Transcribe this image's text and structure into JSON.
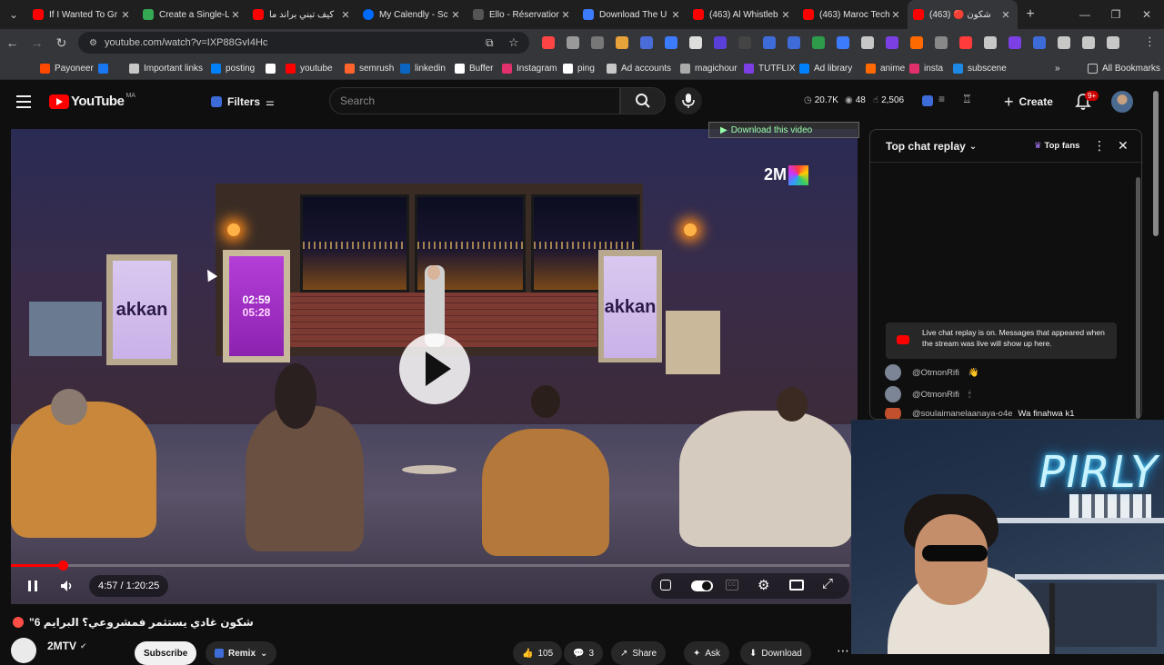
{
  "browser": {
    "tabs": [
      {
        "title": "If I Wanted To Gr",
        "icon": "youtube-icon",
        "color": "#ff0000"
      },
      {
        "title": "Create a Single-L",
        "icon": "sheets-icon",
        "color": "#34a853"
      },
      {
        "title": "كيف تبني براند ما",
        "icon": "youtube-icon",
        "color": "#ff0000"
      },
      {
        "title": "My Calendly - Sc",
        "icon": "calendly-icon",
        "color": "#006bff"
      },
      {
        "title": "Ello - Réservation",
        "icon": "ello-icon",
        "color": "#555555"
      },
      {
        "title": "Download The U",
        "icon": "download-icon",
        "color": "#3d7bfd"
      },
      {
        "title": "(463) Al Whistleb",
        "icon": "youtube-icon",
        "color": "#ff0000"
      },
      {
        "title": "(463) Maroc Tech",
        "icon": "youtube-icon",
        "color": "#ff0000"
      },
      {
        "title": "(463) 🔴 شكون",
        "icon": "youtube-icon",
        "color": "#ff0000",
        "active": true
      }
    ],
    "url": "youtube.com/watch?v=IXP88GvI4Hc",
    "bookmarks": [
      {
        "label": "Payoneer",
        "icon": "payoneer-icon",
        "color": "#ff4800"
      },
      {
        "label": "",
        "icon": "facebook-icon",
        "color": "#1877f2"
      },
      {
        "label": "Important links",
        "icon": "folder-icon",
        "color": "#c7c7c7"
      },
      {
        "label": "posting",
        "icon": "meta-icon",
        "color": "#0081fb"
      },
      {
        "label": "",
        "icon": "google-icon",
        "color": "#ffffff"
      },
      {
        "label": "youtube",
        "icon": "youtube-icon",
        "color": "#ff0000"
      },
      {
        "label": "semrush",
        "icon": "semrush-icon",
        "color": "#ff642d"
      },
      {
        "label": "linkedin",
        "icon": "linkedin-icon",
        "color": "#0a66c2"
      },
      {
        "label": "Buffer",
        "icon": "buffer-icon",
        "color": "#ffffff"
      },
      {
        "label": "Instagram",
        "icon": "instagram-icon",
        "color": "#e1306c"
      },
      {
        "label": "ping",
        "icon": "ping-icon",
        "color": "#ffffff"
      },
      {
        "label": "Ad accounts",
        "icon": "folder-icon",
        "color": "#c7c7c7"
      },
      {
        "label": "magichour",
        "icon": "magichour-icon",
        "color": "#aaaaaa"
      },
      {
        "label": "TUTFLIX",
        "icon": "tutflix-icon",
        "color": "#7b3fe4"
      },
      {
        "label": "Ad library",
        "icon": "meta-icon",
        "color": "#0081fb"
      },
      {
        "label": "anime",
        "icon": "anime-icon",
        "color": "#ff6a00"
      },
      {
        "label": "insta",
        "icon": "instagram-icon",
        "color": "#e1306c"
      },
      {
        "label": "subscene",
        "icon": "subscene-icon",
        "color": "#1e88e5"
      }
    ],
    "all_bookmarks": "All Bookmarks"
  },
  "youtube": {
    "brand": "YouTube",
    "country": "MA",
    "filters_label": "Filters",
    "search_placeholder": "Search",
    "stats": {
      "views": "20.7K",
      "watching": "48",
      "likes": "2,506"
    },
    "create_label": "Create",
    "notif_badge": "9+"
  },
  "player": {
    "download_overlay": "Download this video",
    "timer_top": "02:59",
    "timer_bottom": "05:28",
    "brand_left": "akkan",
    "brand_right": "akkan",
    "channel_logo": "2M",
    "time_current": "4:57",
    "time_total": "1:20:25",
    "time_display": "4:57 / 1:20:25",
    "progress": 0.0616
  },
  "video": {
    "title": "شكون غادي يستثمر فمشروعي؟ البرايم 6\"",
    "channel": "2MTV",
    "subscribe": "Subscribe",
    "remix": "Remix",
    "likes": "105",
    "comments": "3",
    "share": "Share",
    "ask": "Ask",
    "download": "Download"
  },
  "chat": {
    "title": "Top chat replay",
    "top_fans": "Top fans",
    "notice": "Live chat replay is on. Messages that appeared when the stream was live will show up here.",
    "messages": [
      {
        "author": "@OtmonRifi",
        "text": "👋"
      },
      {
        "author": "@OtmonRifi",
        "text": "🕯"
      },
      {
        "author": "@soulaimanelaanaya-o4e",
        "text": "Wa finahwa k1"
      }
    ]
  },
  "webcam": {
    "neon_text": "PIRLY"
  },
  "colors": {
    "yt_red": "#ff0000",
    "bg": "#0f0f0f",
    "chrome_tab": "#35363a"
  }
}
